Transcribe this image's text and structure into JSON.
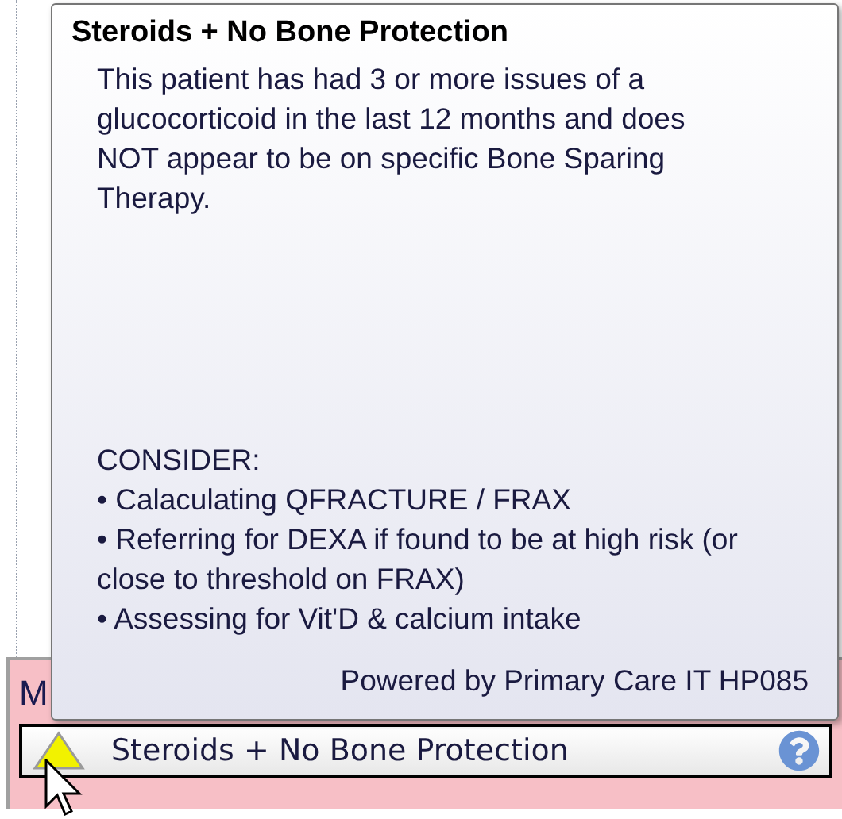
{
  "panel": {
    "label": "M"
  },
  "tooltip": {
    "title": "Steroids + No Bone Protection",
    "message": "This patient has had 3 or more issues of a glucocorticoid in the last 12 months and does NOT appear to be on specific Bone Sparing Therapy.",
    "consider_heading": "CONSIDER:",
    "consider_items": [
      "• Calaculating QFRACTURE / FRAX",
      "• Referring for DEXA if found to be at high risk (or close to threshold on FRAX)",
      "• Assessing for Vit'D & calcium intake"
    ],
    "footer": "Powered by Primary Care IT HP085"
  },
  "alert": {
    "label": "Steroids + No Bone Protection"
  }
}
